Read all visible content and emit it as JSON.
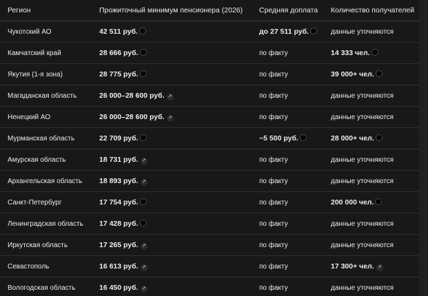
{
  "table": {
    "headers": [
      "Регион",
      "Прожиточный минимум пенсионера (2026)",
      "Средняя доплата",
      "Количество получателей"
    ],
    "rows": [
      {
        "region": "Чукотский АО",
        "min": "42 511 руб.",
        "min_icon": "source-dot-icon",
        "surcharge": "до 27 511 руб.",
        "surcharge_icon": "source-dot-icon",
        "recipients": "данные уточняются",
        "recipients_icon": ""
      },
      {
        "region": "Камчатский край",
        "min": "28 666 руб.",
        "min_icon": "source-dot-icon",
        "surcharge": "по факту",
        "surcharge_icon": "",
        "recipients": "14 333 чел.",
        "recipients_icon": "source-dot-icon"
      },
      {
        "region": "Якутия (1-я зона)",
        "min": "28 775 руб.",
        "min_icon": "source-dot-icon",
        "surcharge": "по факту",
        "surcharge_icon": "",
        "recipients": "39 000+ чел.",
        "recipients_icon": "source-dot-icon"
      },
      {
        "region": "Магаданская область",
        "min": "26 000–28 600 руб.",
        "min_icon": "source-link-icon",
        "surcharge": "по факту",
        "surcharge_icon": "",
        "recipients": "данные уточняются",
        "recipients_icon": ""
      },
      {
        "region": "Ненецкий АО",
        "min": "26 000–28 600 руб.",
        "min_icon": "source-link-icon",
        "surcharge": "по факту",
        "surcharge_icon": "",
        "recipients": "данные уточняются",
        "recipients_icon": ""
      },
      {
        "region": "Мурманская область",
        "min": "22 709 руб.",
        "min_icon": "source-dot-icon",
        "surcharge": "~5 500 руб.",
        "surcharge_icon": "source-dot-icon",
        "recipients": "28 000+ чел.",
        "recipients_icon": "source-dot-icon"
      },
      {
        "region": "Амурская область",
        "min": "18 731 руб.",
        "min_icon": "source-link-icon",
        "surcharge": "по факту",
        "surcharge_icon": "",
        "recipients": "данные уточняются",
        "recipients_icon": ""
      },
      {
        "region": "Архангельская область",
        "min": "18 893 руб.",
        "min_icon": "source-link-icon",
        "surcharge": "по факту",
        "surcharge_icon": "",
        "recipients": "данные уточняются",
        "recipients_icon": ""
      },
      {
        "region": "Санкт-Петербург",
        "min": "17 754 руб.",
        "min_icon": "source-dot-icon",
        "surcharge": "по факту",
        "surcharge_icon": "",
        "recipients": "200 000 чел.",
        "recipients_icon": "source-dot-icon"
      },
      {
        "region": "Ленинградская область",
        "min": "17 428 руб.",
        "min_icon": "source-dot-icon",
        "surcharge": "по факту",
        "surcharge_icon": "",
        "recipients": "данные уточняются",
        "recipients_icon": ""
      },
      {
        "region": "Иркутская область",
        "min": "17 265 руб.",
        "min_icon": "source-link-icon",
        "surcharge": "по факту",
        "surcharge_icon": "",
        "recipients": "данные уточняются",
        "recipients_icon": ""
      },
      {
        "region": "Севастополь",
        "min": "16 613 руб.",
        "min_icon": "source-link-icon",
        "surcharge": "по факту",
        "surcharge_icon": "",
        "recipients": "17 300+ чел.",
        "recipients_icon": "source-link-icon"
      },
      {
        "region": "Вологодская область",
        "min": "16 450 руб.",
        "min_icon": "source-link-icon",
        "surcharge": "по факту",
        "surcharge_icon": "",
        "recipients": "данные уточняются",
        "recipients_icon": ""
      }
    ]
  },
  "colors": {
    "background": "#181818",
    "text": "#ececec",
    "row_border": "#303030",
    "header_border": "#3e3e3e"
  }
}
